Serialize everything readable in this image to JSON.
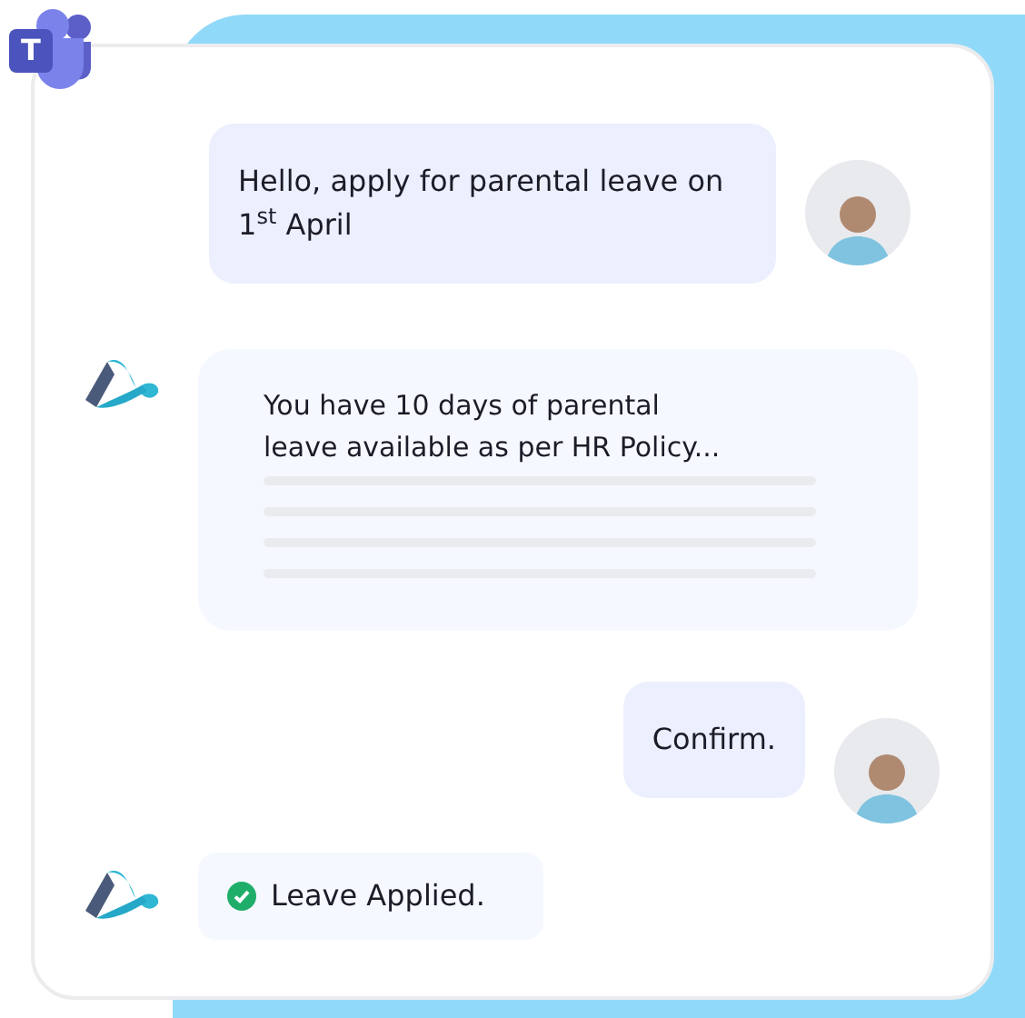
{
  "app_logo": {
    "letter": "T"
  },
  "messages": [
    {
      "kind": "user",
      "text": "Hello, apply for parental leave on 1$^{st}$ April"
    },
    {
      "kind": "bot_reply",
      "text": "You have 10 days of parental leave available as per HR Policy..."
    },
    {
      "kind": "user",
      "text": "Confirm."
    },
    {
      "kind": "bot_success",
      "text": "Leave Applied."
    }
  ]
}
